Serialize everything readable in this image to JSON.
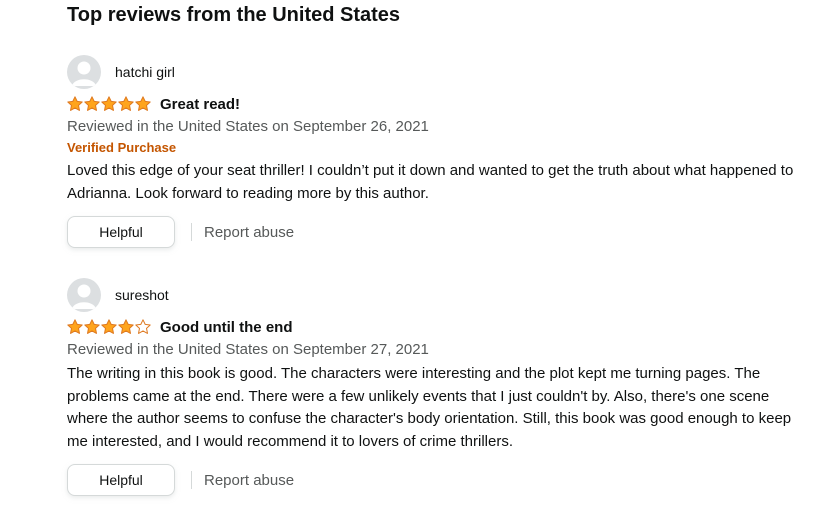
{
  "section": {
    "heading": "Top reviews from the United States"
  },
  "colors": {
    "star_fill": "#ffa41c",
    "star_outline": "#de7921",
    "verified": "#c45500",
    "muted_text": "#565959"
  },
  "reviews": [
    {
      "author": "hatchi girl",
      "rating": 5,
      "rating_max": 5,
      "title": "Great read!",
      "date": "Reviewed in the United States on September 26, 2021",
      "verified": "Verified Purchase",
      "body": "Loved this edge of your seat thriller! I couldn’t put it down and wanted to get the truth about what happened to Adrianna. Look forward to reading more by this author.",
      "helpful_label": "Helpful",
      "report_label": "Report abuse"
    },
    {
      "author": "sureshot",
      "rating": 4,
      "rating_max": 5,
      "title": "Good until the end",
      "date": "Reviewed in the United States on September 27, 2021",
      "body": "The writing in this book is good. The characters were interesting and the plot kept me turning pages. The problems came at the end. There were a few unlikely events that I just couldn't by. Also, there's one scene where the author seems to confuse the character's body orientation. Still, this book was good enough to keep me interested, and I would recommend it to lovers of crime thrillers.",
      "helpful_label": "Helpful",
      "report_label": "Report abuse"
    }
  ]
}
